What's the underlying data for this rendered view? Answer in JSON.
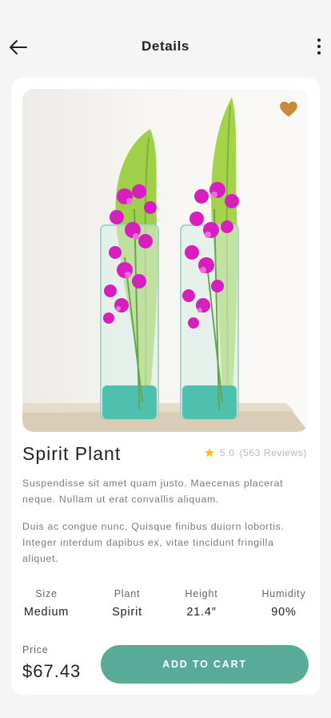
{
  "header": {
    "title": "Details",
    "back_icon": "arrow-left-icon",
    "menu_icon": "more-vertical-icon"
  },
  "product": {
    "name": "Spirit Plant",
    "rating": "5.0",
    "reviews": "(563 Reviews)",
    "favorite": true,
    "description": [
      "Suspendisse sit amet quam justo. Maecenas  placerat neque. Nullam ut erat convallis aliquam.",
      "Duis ac congue nunc. Quisque finibus duiorn lobortis. Integer interdum dapibus ex, vitae tincidunt  fringilla aliquet."
    ],
    "specs": [
      {
        "label": "Size",
        "value": "Medium"
      },
      {
        "label": "Plant",
        "value": "Spirit"
      },
      {
        "label": "Height",
        "value": "21.4″"
      },
      {
        "label": "Humidity",
        "value": "90%"
      }
    ],
    "price_label": "Price",
    "price": "$67.43",
    "cart_label": "ADD TO CART"
  },
  "colors": {
    "accent": "#58ab96",
    "heart": "#c98a3a",
    "star": "#f2c31b"
  }
}
